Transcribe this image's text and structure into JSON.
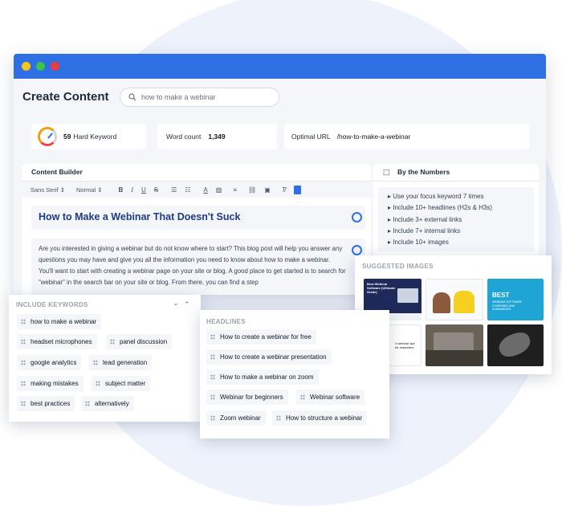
{
  "window": {
    "title": "Create Content",
    "traffic_lights": [
      "#f5c518",
      "#3ac44b",
      "#ee3b3b"
    ],
    "accent": "#2f6fe4"
  },
  "search": {
    "value": "how to make a webinar",
    "icon": "search-icon"
  },
  "stats": {
    "difficulty_value": "59",
    "difficulty_label": "Hard Keyword",
    "word_count_label": "Word count",
    "word_count_value": "1,349",
    "optimal_url_label": "Optimal URL",
    "optimal_url_value": "/how-to-make-a-webinar"
  },
  "builder": {
    "title": "Content Builder",
    "font_select": "Sans Serif",
    "size_select": "Normal",
    "article_title": "How to Make a Webinar That Doesn't Suck",
    "article_body": "Are you interested in giving a webinar but do not know where to start? This blog post will help you answer any questions you may have and give you all the information you need to know about how to make a webinar. You'll want to start with creating a webinar page on your site or blog. A good place to get started is to search for \"webinar\" in the search bar on your site or blog. From there, you can find a step"
  },
  "numbers": {
    "title": "By the Numbers",
    "items": [
      "Use your focus keyword 7 times",
      "Include 10+ headlines (H2s & H3s)",
      "Include 3+ external links",
      "Include 7+ internal links",
      "Include 10+ images"
    ]
  },
  "images": {
    "title": "SUGGESTED IMAGES",
    "tile1_title": "Best Webinar Software (Ultimate Guide)",
    "tile3_title": "BEST",
    "tile3_sub": "WEBINAR SOFTWARE COMPARED AND SUMMARIZED",
    "tile4_text": "4 webinar tips for marketers"
  },
  "keywords": {
    "title": "INCLUDE KEYWORDS",
    "items": [
      "how to make a webinar",
      "headset microphones",
      "panel discussion",
      "google analytics",
      "lead generation",
      "making mistakes",
      "subject matter",
      "best practices",
      "alternatively"
    ]
  },
  "headlines": {
    "title": "HEADLINES",
    "items": [
      "How to create a webinar for free",
      "How to create a webinar presentation",
      "How to make a webinar on zoom",
      "Webinar for beginners",
      "Webinar software",
      "Zoom webinar",
      "How to structure a webinar"
    ]
  }
}
